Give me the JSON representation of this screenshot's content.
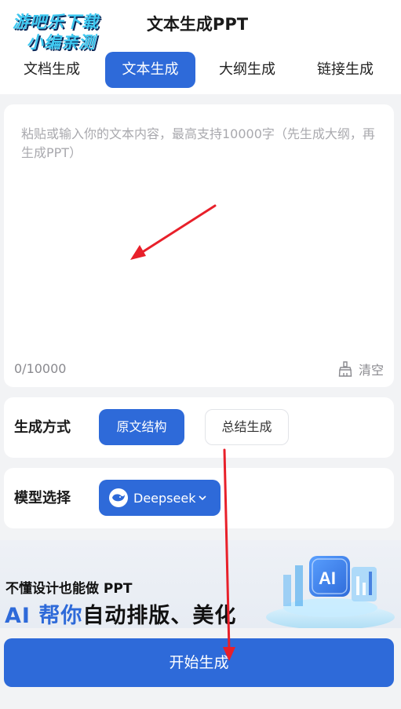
{
  "watermark": {
    "line1": "游吧乐下载",
    "line2": "小编亲测"
  },
  "header": {
    "title": "文本生成PPT"
  },
  "tabs": [
    {
      "label": "文档生成",
      "active": false
    },
    {
      "label": "文本生成",
      "active": true
    },
    {
      "label": "大纲生成",
      "active": false
    },
    {
      "label": "链接生成",
      "active": false
    }
  ],
  "text_input": {
    "placeholder": "粘贴或输入你的文本内容，最高支持10000字（先生成大纲，再生成PPT）",
    "value": "",
    "counter": "0/10000",
    "clear_label": "清空"
  },
  "generation_method": {
    "label": "生成方式",
    "options": [
      {
        "label": "原文结构",
        "selected": true
      },
      {
        "label": "总结生成",
        "selected": false
      }
    ]
  },
  "model": {
    "label": "模型选择",
    "selected": "Deepseek",
    "icon": "deepseek-whale-icon"
  },
  "banner": {
    "subtitle": "不懂设计也能做 PPT",
    "headline_highlight": "AI 帮你",
    "headline_rest": "自动排版、美化"
  },
  "start_button": {
    "label": "开始生成"
  },
  "colors": {
    "accent": "#2e6ad9",
    "background": "#f2f3f5",
    "annotation_arrow": "#e8202a"
  }
}
